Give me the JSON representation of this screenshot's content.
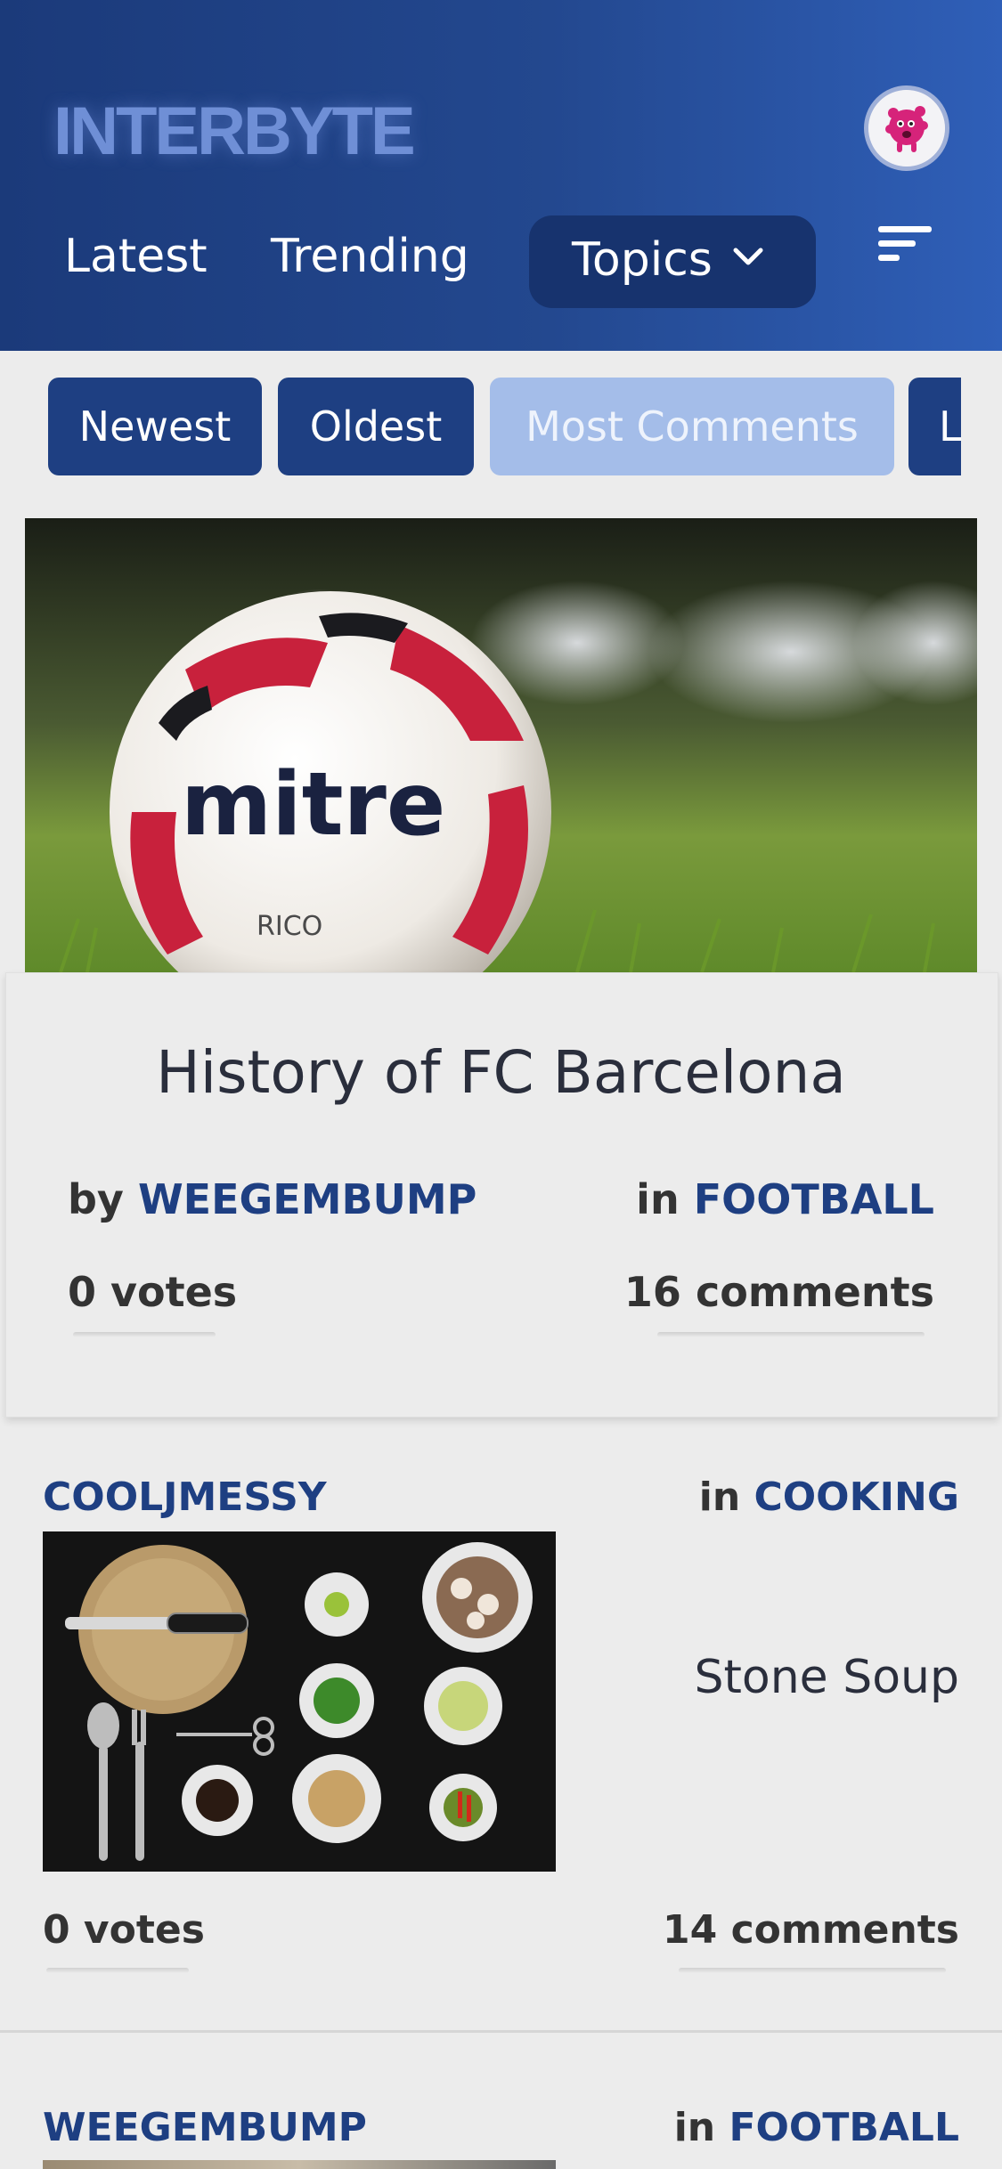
{
  "app": {
    "logo": "INTERBYTE"
  },
  "nav": {
    "latest": "Latest",
    "trending": "Trending",
    "topics": "Topics"
  },
  "filters": [
    "Newest",
    "Oldest",
    "Most Comments",
    "L"
  ],
  "active_filter": "Most Comments",
  "featured": {
    "title": "History of FC Barcelona",
    "by_prefix": "by",
    "author": "WEEGEMBUMP",
    "in_prefix": "in",
    "topic": "FOOTBALL",
    "votes": "0 votes",
    "comments": "16 comments",
    "image_text": "mitre",
    "image_text_small": "RICO"
  },
  "posts": [
    {
      "author": "COOLJMESSY",
      "in_prefix": "in",
      "topic": "COOKING",
      "title": "Stone Soup",
      "votes": "0 votes",
      "comments": "14 comments"
    },
    {
      "author": "WEEGEMBUMP",
      "in_prefix": "in",
      "topic": "FOOTBALL"
    }
  ],
  "colors": {
    "header_start": "#1b3a7a",
    "header_end": "#2f5fb8",
    "accent": "#1e3f82",
    "chip_active": "#a4bde9",
    "background": "#ececec"
  },
  "icons": {
    "avatar": "pink-monster-avatar",
    "topics": "chevron-down-icon",
    "menu": "sort-menu-icon"
  }
}
